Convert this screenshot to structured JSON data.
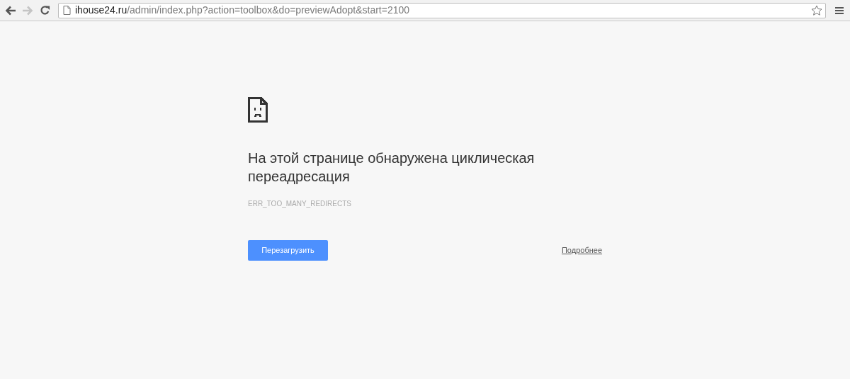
{
  "toolbar": {
    "nav_buttons": [
      {
        "kind": "back",
        "disabled": false
      },
      {
        "kind": "forward",
        "disabled": true
      },
      {
        "kind": "reload",
        "disabled": false
      }
    ],
    "address": {
      "host": "ihouse24.ru",
      "path": "/admin/index.php?action=toolbox&do=previewAdopt&start=2100"
    }
  },
  "error": {
    "title": "На этой странице обнаружена циклическая переадресация",
    "code": "ERR_TOO_MANY_REDIRECTS",
    "reload_button": "Перезагрузить",
    "details_link": "Подробнее"
  }
}
